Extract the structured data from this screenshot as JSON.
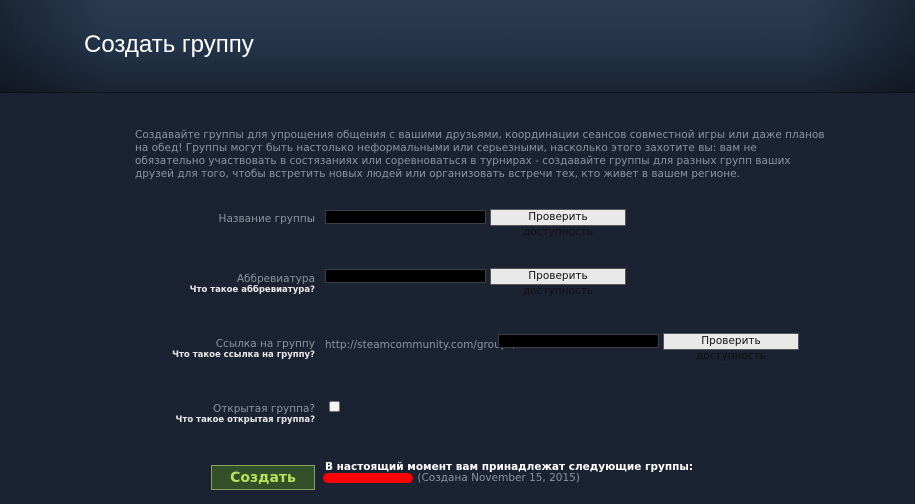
{
  "page": {
    "title": "Создать группу",
    "intro": "Создавайте группы для упрощения общения с вашими друзьями, координации сеансов совместной игры или даже планов на обед! Группы могут быть настолько неформальными или серьезными, насколько этого захотите вы: вам не обязательно участвовать в состязаниях или соревноваться в турнирах - создавайте группы для разных групп ваших друзей для того, чтобы встретить новых людей или организовать встречи тех, кто живет в вашем регионе."
  },
  "form": {
    "name": {
      "label": "Название группы",
      "value": "",
      "check_label": "Проверить доступность"
    },
    "abbreviation": {
      "label": "Аббревиатура",
      "help": "Что такое аббревиатура?",
      "value": "",
      "check_label": "Проверить доступность"
    },
    "url": {
      "label": "Ссылка на группу",
      "help": "Что такое ссылка на группу?",
      "prefix": "http://steamcommunity.com/groups/",
      "value": "",
      "check_label": "Проверить доступность"
    },
    "public": {
      "label": "Открытая группа?",
      "help": "Что такое открытая группа?",
      "checked": false
    },
    "submit_label": "Создать"
  },
  "owned_groups": {
    "heading": "В настоящий момент вам принадлежат следующие группы:",
    "items": [
      {
        "name_redacted": true,
        "created": "(Создана November 15, 2015)"
      }
    ]
  },
  "colors": {
    "background": "#1b2332",
    "submit_text": "#b6e35a",
    "redaction": "#ff0000"
  }
}
